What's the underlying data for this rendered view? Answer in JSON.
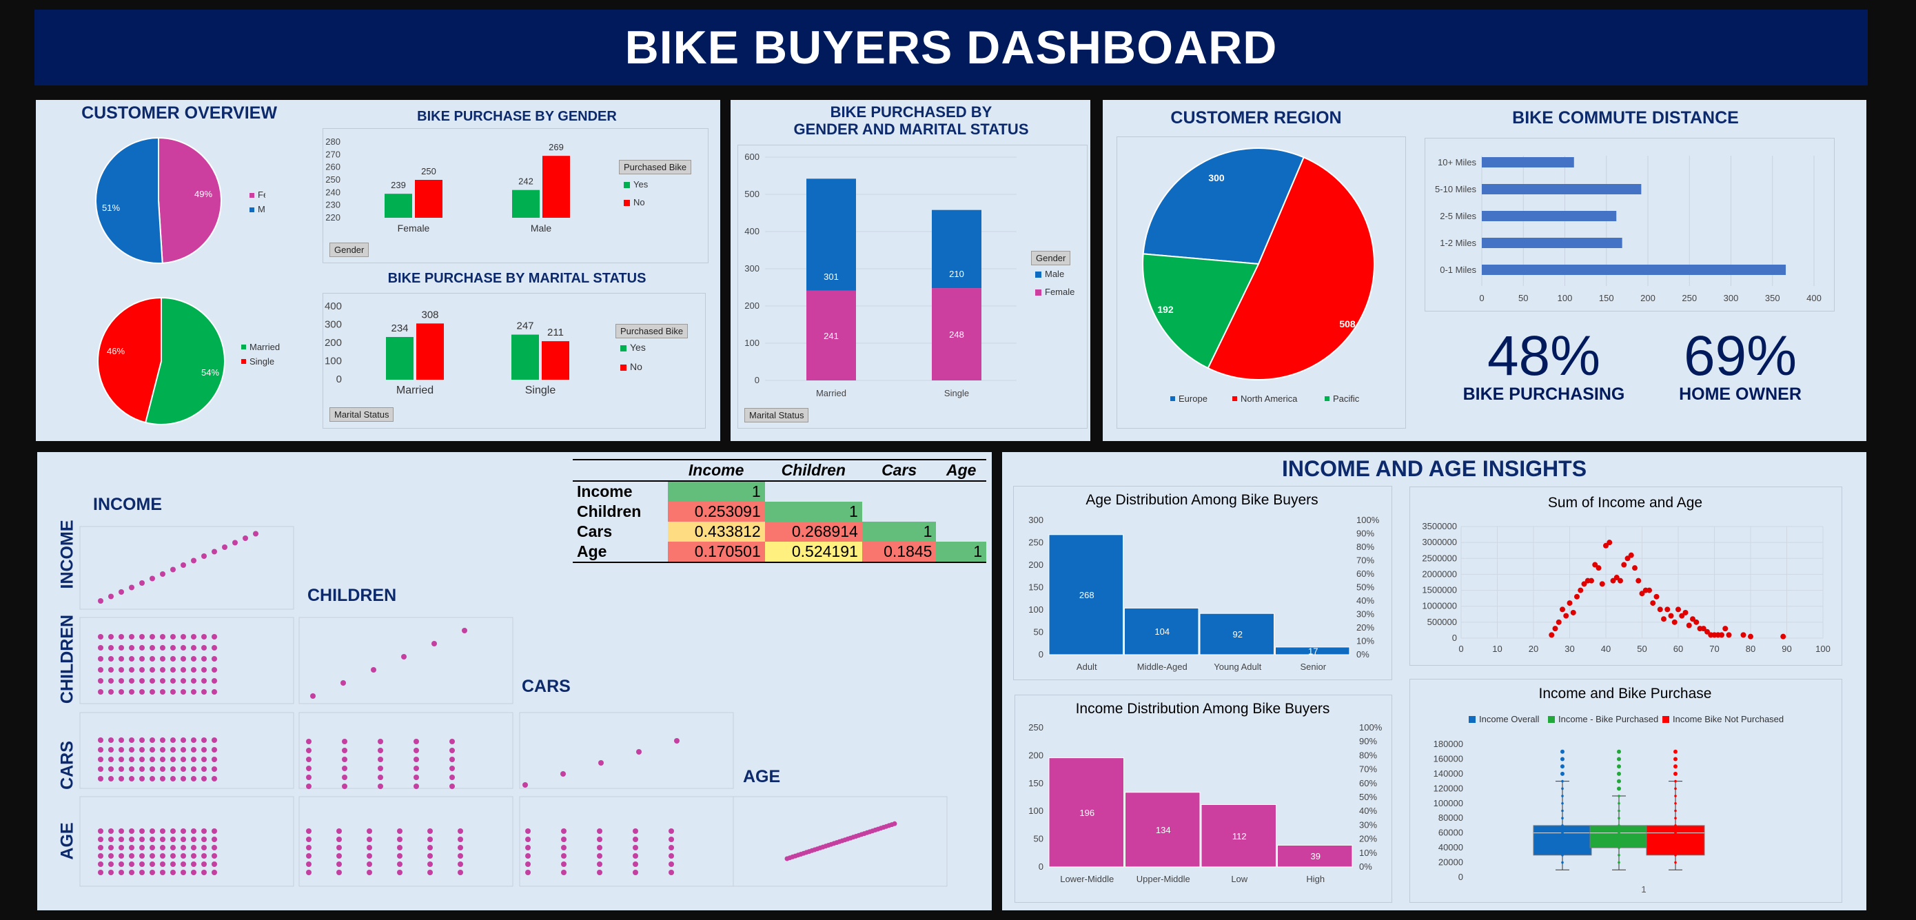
{
  "title": "BIKE BUYERS DASHBOARD",
  "customer_overview": {
    "title": "CUSTOMER OVERVIEW"
  },
  "gender_pie": {
    "female_pct": "49%",
    "male_pct": "51%",
    "legend": [
      "Female",
      "Male"
    ],
    "values": [
      49,
      51
    ],
    "colors": [
      "#cc3f9e",
      "#0e6bc0"
    ]
  },
  "marital_pie": {
    "single_pct": "46%",
    "married_pct": "54%",
    "legend": [
      "Married",
      "Single"
    ],
    "values": [
      54,
      46
    ],
    "colors": [
      "#00b050",
      "#ff0000"
    ]
  },
  "gender_bar": {
    "title": "BIKE PURCHASE BY GENDER",
    "categories": [
      "Female",
      "Male"
    ],
    "yes": [
      239,
      242
    ],
    "no": [
      250,
      269
    ],
    "yticks": [
      "220",
      "230",
      "240",
      "250",
      "260",
      "270",
      "280"
    ],
    "slicer": "Purchased Bike",
    "legend_yes": "Yes",
    "legend_no": "No",
    "filter": "Gender"
  },
  "marital_bar": {
    "title": "BIKE PURCHASE BY MARITAL STATUS",
    "categories": [
      "Married",
      "Single"
    ],
    "yes": [
      234,
      247
    ],
    "no": [
      308,
      211
    ],
    "yticks": [
      "0",
      "100",
      "200",
      "300",
      "400"
    ],
    "slicer": "Purchased Bike",
    "legend_yes": "Yes",
    "legend_no": "No",
    "filter": "Marital Status"
  },
  "stacked": {
    "title_line1": "BIKE PURCHASED BY",
    "title_line2": "GENDER AND MARITAL STATUS",
    "categories": [
      "Married",
      "Single"
    ],
    "male": [
      301,
      210
    ],
    "female": [
      241,
      248
    ],
    "yticks": [
      "0",
      "100",
      "200",
      "300",
      "400",
      "500",
      "600"
    ],
    "slicer": "Gender",
    "legend_male": "Male",
    "legend_female": "Female",
    "filter": "Marital Status"
  },
  "region": {
    "title": "CUSTOMER REGION",
    "values": [
      300,
      508,
      192
    ],
    "labels": [
      "300",
      "508",
      "192"
    ],
    "legend": [
      "Europe",
      "North America",
      "Pacific"
    ],
    "colors": [
      "#0e6bc0",
      "#ff0000",
      "#00b050"
    ]
  },
  "commute": {
    "title": "BIKE COMMUTE DISTANCE",
    "categories": [
      "10+ Miles",
      "5-10 Miles",
      "2-5 Miles",
      "1-2 Miles",
      "0-1 Miles"
    ],
    "values": [
      111,
      192,
      162,
      169,
      366
    ],
    "xticks": [
      "0",
      "50",
      "100",
      "150",
      "200",
      "250",
      "300",
      "350",
      "400"
    ]
  },
  "kpi": {
    "pct1": "48%",
    "label1": "BIKE PURCHASING",
    "pct2": "69%",
    "label2": "HOME OWNER"
  },
  "corr": {
    "headers": [
      "Income",
      "Children",
      "Cars",
      "Age"
    ],
    "rows": [
      {
        "label": "Income",
        "values": [
          "1",
          "",
          "",
          ""
        ]
      },
      {
        "label": "Children",
        "values": [
          "0.253091",
          "1",
          "",
          ""
        ]
      },
      {
        "label": "Cars",
        "values": [
          "0.433812",
          "0.268914",
          "1",
          ""
        ]
      },
      {
        "label": "Age",
        "values": [
          "0.170501",
          "0.524191",
          "0.1845",
          "1"
        ]
      }
    ]
  },
  "scatter_matrix": {
    "labels": [
      "INCOME",
      "CHILDREN",
      "CARS",
      "AGE"
    ],
    "row_labels": [
      "INCOME",
      "CHILDREN",
      "CARS",
      "AGE"
    ]
  },
  "insights": {
    "title": "INCOME AND AGE INSIGHTS"
  },
  "age_dist": {
    "title": "Age Distribution Among Bike Buyers",
    "categories": [
      "Adult",
      "Middle-Aged",
      "Young Adult",
      "Senior"
    ],
    "values": [
      268,
      104,
      92,
      17
    ],
    "yticks": [
      "0",
      "50",
      "100",
      "150",
      "200",
      "250",
      "300"
    ],
    "pticks": [
      "0%",
      "10%",
      "20%",
      "30%",
      "40%",
      "50%",
      "60%",
      "70%",
      "80%",
      "90%",
      "100%"
    ]
  },
  "income_dist": {
    "title": "Income Distribution Among Bike Buyers",
    "categories": [
      "Lower-Middle",
      "Upper-Middle",
      "Low",
      "High"
    ],
    "values": [
      196,
      134,
      112,
      39
    ],
    "yticks": [
      "0",
      "50",
      "100",
      "150",
      "200",
      "250"
    ],
    "pticks": [
      "0%",
      "10%",
      "20%",
      "30%",
      "40%",
      "50%",
      "60%",
      "70%",
      "80%",
      "90%",
      "100%"
    ]
  },
  "sum_scatter": {
    "title": "Sum of Income and Age",
    "xticks": [
      "0",
      "10",
      "20",
      "30",
      "40",
      "50",
      "60",
      "70",
      "80",
      "90",
      "100"
    ],
    "yticks": [
      "0",
      "500000",
      "1000000",
      "1500000",
      "2000000",
      "2500000",
      "3000000",
      "3500000"
    ]
  },
  "box": {
    "title": "Income and Bike Purchase",
    "legend": [
      "Income Overall",
      "Income - Bike Purchased",
      "Income Bike Not Purchased"
    ],
    "colors": [
      "#0e6bc0",
      "#22a83a",
      "#ff0000"
    ],
    "yticks": [
      "0",
      "20000",
      "40000",
      "60000",
      "80000",
      "100000",
      "120000",
      "140000",
      "160000",
      "180000"
    ],
    "xlabel": "1"
  },
  "chart_data": [
    {
      "type": "pie",
      "title": "CUSTOMER OVERVIEW",
      "categories": [
        "Female",
        "Male"
      ],
      "values": [
        49,
        51
      ]
    },
    {
      "type": "pie",
      "categories": [
        "Married",
        "Single"
      ],
      "values": [
        54,
        46
      ]
    },
    {
      "type": "bar",
      "title": "BIKE PURCHASE BY GENDER",
      "categories": [
        "Female",
        "Male"
      ],
      "series": [
        {
          "name": "Yes",
          "values": [
            239,
            242
          ]
        },
        {
          "name": "No",
          "values": [
            250,
            269
          ]
        }
      ],
      "ylim": [
        220,
        280
      ]
    },
    {
      "type": "bar",
      "title": "BIKE PURCHASE BY MARITAL STATUS",
      "categories": [
        "Married",
        "Single"
      ],
      "series": [
        {
          "name": "Yes",
          "values": [
            234,
            247
          ]
        },
        {
          "name": "No",
          "values": [
            308,
            211
          ]
        }
      ],
      "ylim": [
        0,
        400
      ]
    },
    {
      "type": "bar",
      "title": "BIKE PURCHASED BY GENDER AND MARITAL STATUS",
      "categories": [
        "Married",
        "Single"
      ],
      "series": [
        {
          "name": "Female",
          "values": [
            241,
            248
          ]
        },
        {
          "name": "Male",
          "values": [
            301,
            210
          ]
        }
      ],
      "ylim": [
        0,
        600
      ]
    },
    {
      "type": "pie",
      "title": "CUSTOMER REGION",
      "categories": [
        "Europe",
        "North America",
        "Pacific"
      ],
      "values": [
        300,
        508,
        192
      ]
    },
    {
      "type": "bar",
      "title": "BIKE COMMUTE DISTANCE",
      "categories": [
        "10+ Miles",
        "5-10 Miles",
        "2-5 Miles",
        "1-2 Miles",
        "0-1 Miles"
      ],
      "values": [
        111,
        192,
        162,
        169,
        366
      ],
      "xlim": [
        0,
        400
      ]
    },
    {
      "type": "table",
      "headers": [
        "Income",
        "Children",
        "Cars",
        "Age"
      ],
      "rows": [
        [
          "1",
          "",
          "",
          ""
        ],
        [
          "0.253091",
          "1",
          "",
          ""
        ],
        [
          "0.433812",
          "0.268914",
          "1",
          ""
        ],
        [
          "0.170501",
          "0.524191",
          "0.1845",
          "1"
        ]
      ]
    },
    {
      "type": "bar",
      "title": "Age Distribution Among Bike Buyers",
      "categories": [
        "Adult",
        "Middle-Aged",
        "Young Adult",
        "Senior"
      ],
      "values": [
        268,
        104,
        92,
        17
      ],
      "ylim": [
        0,
        300
      ]
    },
    {
      "type": "bar",
      "title": "Income Distribution Among Bike Buyers",
      "categories": [
        "Lower-Middle",
        "Upper-Middle",
        "Low",
        "High"
      ],
      "values": [
        196,
        134,
        112,
        39
      ],
      "ylim": [
        0,
        250
      ]
    },
    {
      "type": "scatter",
      "title": "Sum of Income and Age",
      "x": [
        25,
        26,
        27,
        28,
        29,
        30,
        31,
        32,
        33,
        34,
        35,
        36,
        37,
        38,
        39,
        40,
        41,
        42,
        43,
        44,
        45,
        46,
        47,
        48,
        49,
        50,
        51,
        52,
        53,
        54,
        55,
        56,
        57,
        58,
        59,
        60,
        61,
        62,
        63,
        64,
        65,
        66,
        67,
        68,
        69,
        70,
        71,
        72,
        73,
        74,
        78,
        80,
        89
      ],
      "y": [
        100000,
        300000,
        500000,
        900000,
        700000,
        1100000,
        800000,
        1300000,
        1500000,
        1700000,
        1800000,
        1800000,
        2300000,
        2200000,
        1700000,
        2900000,
        3000000,
        1800000,
        1900000,
        1800000,
        2300000,
        2500000,
        2600000,
        2200000,
        1800000,
        1400000,
        1500000,
        1500000,
        1100000,
        1300000,
        900000,
        600000,
        900000,
        700000,
        500000,
        900000,
        700000,
        800000,
        400000,
        600000,
        500000,
        300000,
        300000,
        200000,
        100000,
        100000,
        100000,
        100000,
        300000,
        100000,
        100000,
        50000,
        50000
      ],
      "xlim": [
        0,
        100
      ],
      "ylim": [
        0,
        3500000
      ]
    },
    {
      "type": "box",
      "title": "Income and Bike Purchase",
      "series": [
        {
          "name": "Income Overall",
          "q1": 30000,
          "median": 60000,
          "q3": 70000,
          "whisker_low": 10000,
          "whisker_high": 130000
        },
        {
          "name": "Income - Bike Purchased",
          "q1": 40000,
          "median": 60000,
          "q3": 70000,
          "whisker_low": 10000,
          "whisker_high": 110000
        },
        {
          "name": "Income Bike Not Purchased",
          "q1": 30000,
          "median": 60000,
          "q3": 70000,
          "whisker_low": 10000,
          "whisker_high": 130000
        }
      ],
      "ylim": [
        0,
        180000
      ]
    }
  ]
}
